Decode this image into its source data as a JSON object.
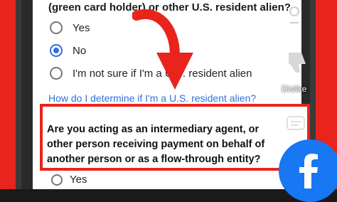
{
  "form": {
    "question_top_fragment": "(green card holder) or other U.S. resident alien?",
    "options": [
      {
        "label": "Yes",
        "checked": false
      },
      {
        "label": "No",
        "checked": true
      },
      {
        "label": "I'm not sure if I'm a U.S. resident alien",
        "checked": false
      }
    ],
    "help_link": "How do I determine if I'm a U.S. resident alien?",
    "question2": "Are you acting as an intermediary agent, or other person receiving payment on behalf of another person or as a flow-through entity?",
    "question2_option_yes": "Yes"
  },
  "overlay": {
    "side_label": "Dislike"
  },
  "colors": {
    "highlight_red": "#e8241c",
    "link_blue": "#2f6fe0",
    "facebook_blue": "#1877f2"
  }
}
